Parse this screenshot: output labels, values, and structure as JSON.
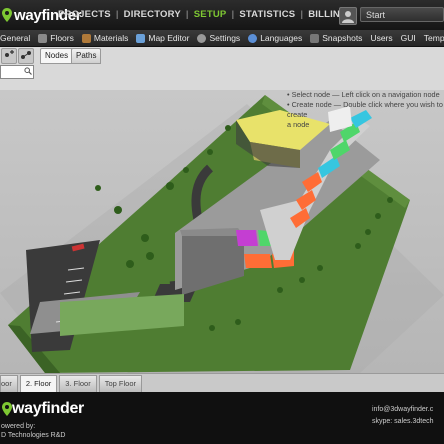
{
  "app": {
    "logo_text": "wayfinder",
    "top_nav": [
      "PROJECTS",
      "DIRECTORY",
      "SETUP",
      "STATISTICS",
      "BILLING"
    ],
    "active_nav": "SETUP",
    "start_label": "Start"
  },
  "tabs": [
    "General",
    "Floors",
    "Materials",
    "Map Editor",
    "Settings",
    "Languages",
    "Snapshots",
    "Users",
    "GUI",
    "Templates"
  ],
  "toolbar": {
    "subtabs": [
      "Nodes",
      "Paths"
    ]
  },
  "instructions": {
    "line1": "Select node — Left click on a navigation node",
    "line2": "Create node — Double click where you wish to create",
    "line3": "a node"
  },
  "floors": [
    "oor",
    "2. Floor",
    "3. Floor",
    "Top Floor"
  ],
  "active_floor": "2. Floor",
  "footer": {
    "logo_text": "wayfinder",
    "powered_line1": "owered by:",
    "powered_line2": "D Technologies R&D",
    "email": "info@3dwayfinder.c",
    "skype": "skype: sales.3dtech"
  },
  "colors": {
    "accent": "#7ec832",
    "header_bg": "#1f1f1f",
    "room_yellow": "#e8e26a",
    "room_cyan": "#36c6e0",
    "room_green": "#4fd66a",
    "room_orange": "#ff6d36",
    "room_magenta": "#c43ed2"
  }
}
